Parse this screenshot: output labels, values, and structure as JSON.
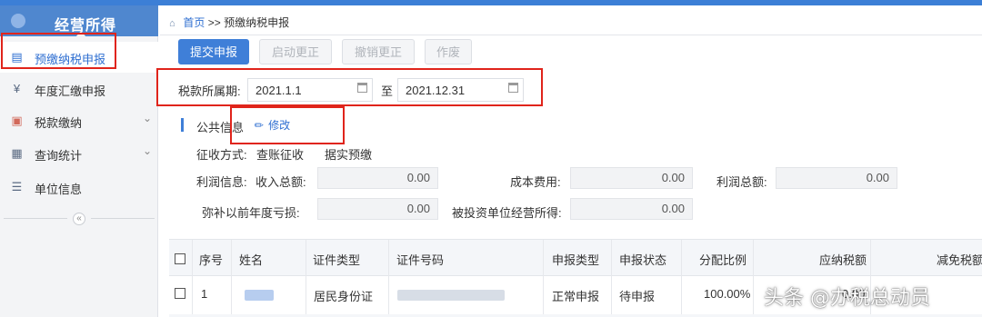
{
  "sidebar": {
    "title": "经营所得",
    "items": [
      {
        "label": "预缴纳税申报",
        "icon": "clipboard-icon"
      },
      {
        "label": "年度汇缴申报",
        "icon": "yen-icon"
      },
      {
        "label": "税款缴纳",
        "icon": "monitor-icon"
      },
      {
        "label": "查询统计",
        "icon": "document-search-icon"
      },
      {
        "label": "单位信息",
        "icon": "list-icon"
      }
    ],
    "collapse_symbol": "«"
  },
  "breadcrumb": {
    "home": "首页",
    "sep": ">>",
    "current": "预缴纳税申报"
  },
  "toolbar": {
    "submit": "提交申报",
    "start_correction": "启动更正",
    "cancel_correction": "撤销更正",
    "void": "作废"
  },
  "period": {
    "label": "税款所属期:",
    "start": "2021.1.1",
    "to": "至",
    "end": "2021.12.31"
  },
  "public_info": {
    "title": "公共信息",
    "edit": "修改"
  },
  "levy": {
    "label": "征收方式:",
    "value": "查账征收",
    "value2": "据实预缴"
  },
  "profit": {
    "label": "利润信息:",
    "total_income_label": "收入总额:",
    "total_income": "0.00",
    "cost_label": "成本费用:",
    "cost": "0.00",
    "total_profit_label": "利润总额:",
    "total_profit": "0.00",
    "prior_loss_label": "弥补以前年度亏损:",
    "prior_loss": "0.00",
    "invested_label": "被投资单位经营所得:",
    "invested": "0.00"
  },
  "table": {
    "headers": [
      "序号",
      "姓名",
      "证件类型",
      "证件号码",
      "申报类型",
      "申报状态",
      "分配比例",
      "应纳税额",
      "减免税额"
    ],
    "rows": [
      {
        "seq": "1",
        "id_type": "居民身份证",
        "decl_type": "正常申报",
        "decl_status": "待申报",
        "ratio": "100.00%",
        "tax_due": "0.00"
      }
    ]
  },
  "watermark": "头条 @办税总动员",
  "colors": {
    "accent": "#3f7fd8",
    "sidebar_header": "#4f87cf",
    "highlight_box": "#e0241b",
    "orange_label": "#e3862a"
  }
}
